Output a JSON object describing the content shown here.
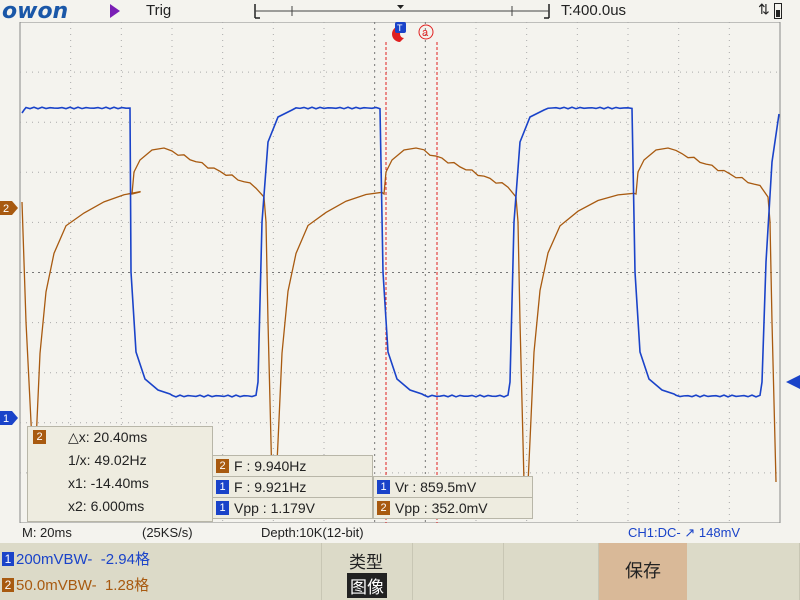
{
  "header": {
    "logo": "OWON",
    "trigger_mode": "Trig",
    "timebase_offset": "T:400.0us",
    "usb_icon": "usb-icon",
    "battery_icon": "battery-icon"
  },
  "markers": {
    "trigger_marker": "T",
    "cursor_a": "a",
    "ch1_marker": "1",
    "ch2_marker": "2"
  },
  "cursor_panel": {
    "channel": "2",
    "dx": "△x: 20.40ms",
    "inv_x": "1/x: 49.02Hz",
    "x1": "x1: -14.40ms",
    "x2": "x2: 6.000ms"
  },
  "measurements": [
    {
      "ch": "2",
      "text": "F : 9.940Hz"
    },
    {
      "ch": "1",
      "text": "F : 9.921Hz"
    },
    {
      "ch": "1",
      "text": "Vpp : 1.179V"
    },
    {
      "ch": "1",
      "text": "Vr : 859.5mV"
    },
    {
      "ch": "2",
      "text": "Vpp : 352.0mV"
    }
  ],
  "status": {
    "timebase": "M: 20ms",
    "sample_rate": "(25KS/s)",
    "depth": "Depth:10K(12-bit)",
    "trigger_info": "CH1:DC- ",
    "trigger_level": "148mV"
  },
  "channels": [
    {
      "num": "1",
      "scale": "200mV",
      "bw": "BW-",
      "offset": "-2.94格",
      "color": "#1a43c9"
    },
    {
      "num": "2",
      "scale": "50.0mV",
      "bw": "BW-",
      "offset": "1.28格",
      "color": "#a85a10"
    }
  ],
  "menu": {
    "type_label": "类型",
    "image_label": "图像",
    "save_label": "保存"
  },
  "colors": {
    "ch1": "#1a43c9",
    "ch2": "#a85a10",
    "cursor": "#e02020"
  }
}
